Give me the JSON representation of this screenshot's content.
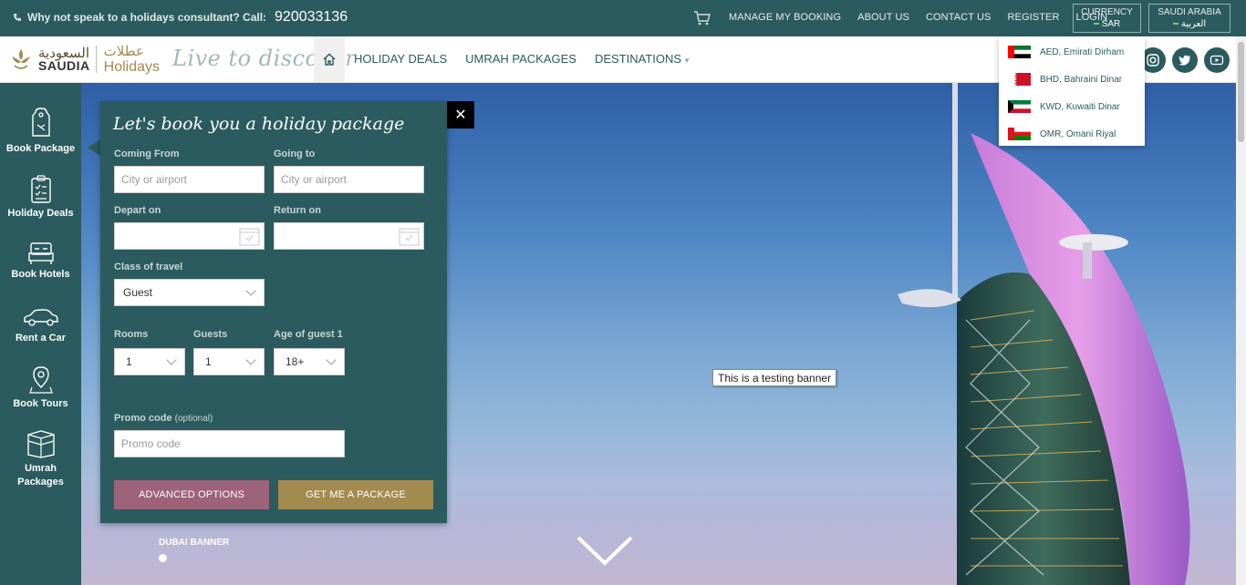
{
  "topbar": {
    "consultant_text": "Why not speak to a holidays consultant? Call:",
    "phone": "920033136",
    "links": [
      "MANAGE MY BOOKING",
      "ABOUT US",
      "CONTACT US",
      "REGISTER",
      "LOGIN"
    ],
    "currency": {
      "label": "CURRENCY",
      "value": "SAR"
    },
    "country": {
      "label": "SAUDI ARABIA",
      "value": "العربية"
    }
  },
  "header": {
    "logo_ar": "السعودية",
    "logo_en": "SAUDIA",
    "logo_holidays_ar": "عطلات",
    "logo_holidays_en": "Holidays",
    "tagline": "Live to discover",
    "nav": [
      "HOLIDAY DEALS",
      "UMRAH PACKAGES",
      "DESTINATIONS"
    ]
  },
  "sidebar": {
    "items": [
      {
        "label": "Book Package",
        "icon": "luggage-tag-icon"
      },
      {
        "label": "Holiday Deals",
        "icon": "checklist-icon"
      },
      {
        "label": "Book Hotels",
        "icon": "bed-icon"
      },
      {
        "label": "Rent a Car",
        "icon": "car-icon"
      },
      {
        "label": "Book Tours",
        "icon": "map-pin-icon"
      },
      {
        "label": "Umrah Packages",
        "icon": "kaaba-icon"
      }
    ]
  },
  "panel": {
    "title": "Let's book you a holiday package",
    "coming_from": {
      "label": "Coming From",
      "placeholder": "City or airport"
    },
    "going_to": {
      "label": "Going to",
      "placeholder": "City or airport"
    },
    "depart_on": {
      "label": "Depart on",
      "value": ""
    },
    "return_on": {
      "label": "Return on",
      "value": ""
    },
    "class_of_travel": {
      "label": "Class of travel",
      "value": "Guest"
    },
    "rooms": {
      "label": "Rooms",
      "value": "1"
    },
    "guests": {
      "label": "Guests",
      "value": "1"
    },
    "age_of_guest": {
      "label": "Age of guest 1",
      "value": "18+"
    },
    "promo": {
      "label": "Promo code",
      "optional": "(optional)",
      "placeholder": "Promo code"
    },
    "advanced_btn": "ADVANCED OPTIONS",
    "submit_btn": "GET ME A PACKAGE",
    "close": "✕"
  },
  "hero": {
    "tooltip": "This is a testing banner",
    "slide_label": "DUBAI BANNER"
  },
  "currency_dropdown": [
    {
      "label": "AED, Emirati Dirham",
      "flag": "uae"
    },
    {
      "label": "BHD, Bahraini Dinar",
      "flag": "bahrain"
    },
    {
      "label": "KWD, Kuwaiti Dinar",
      "flag": "kuwait"
    },
    {
      "label": "OMR, Omani Riyal",
      "flag": "oman"
    }
  ],
  "colors": {
    "primary": "#2b5b5e",
    "advanced_button": "#9d6378",
    "submit_button": "#a38a4f",
    "tagline": "#9fb9b8"
  }
}
